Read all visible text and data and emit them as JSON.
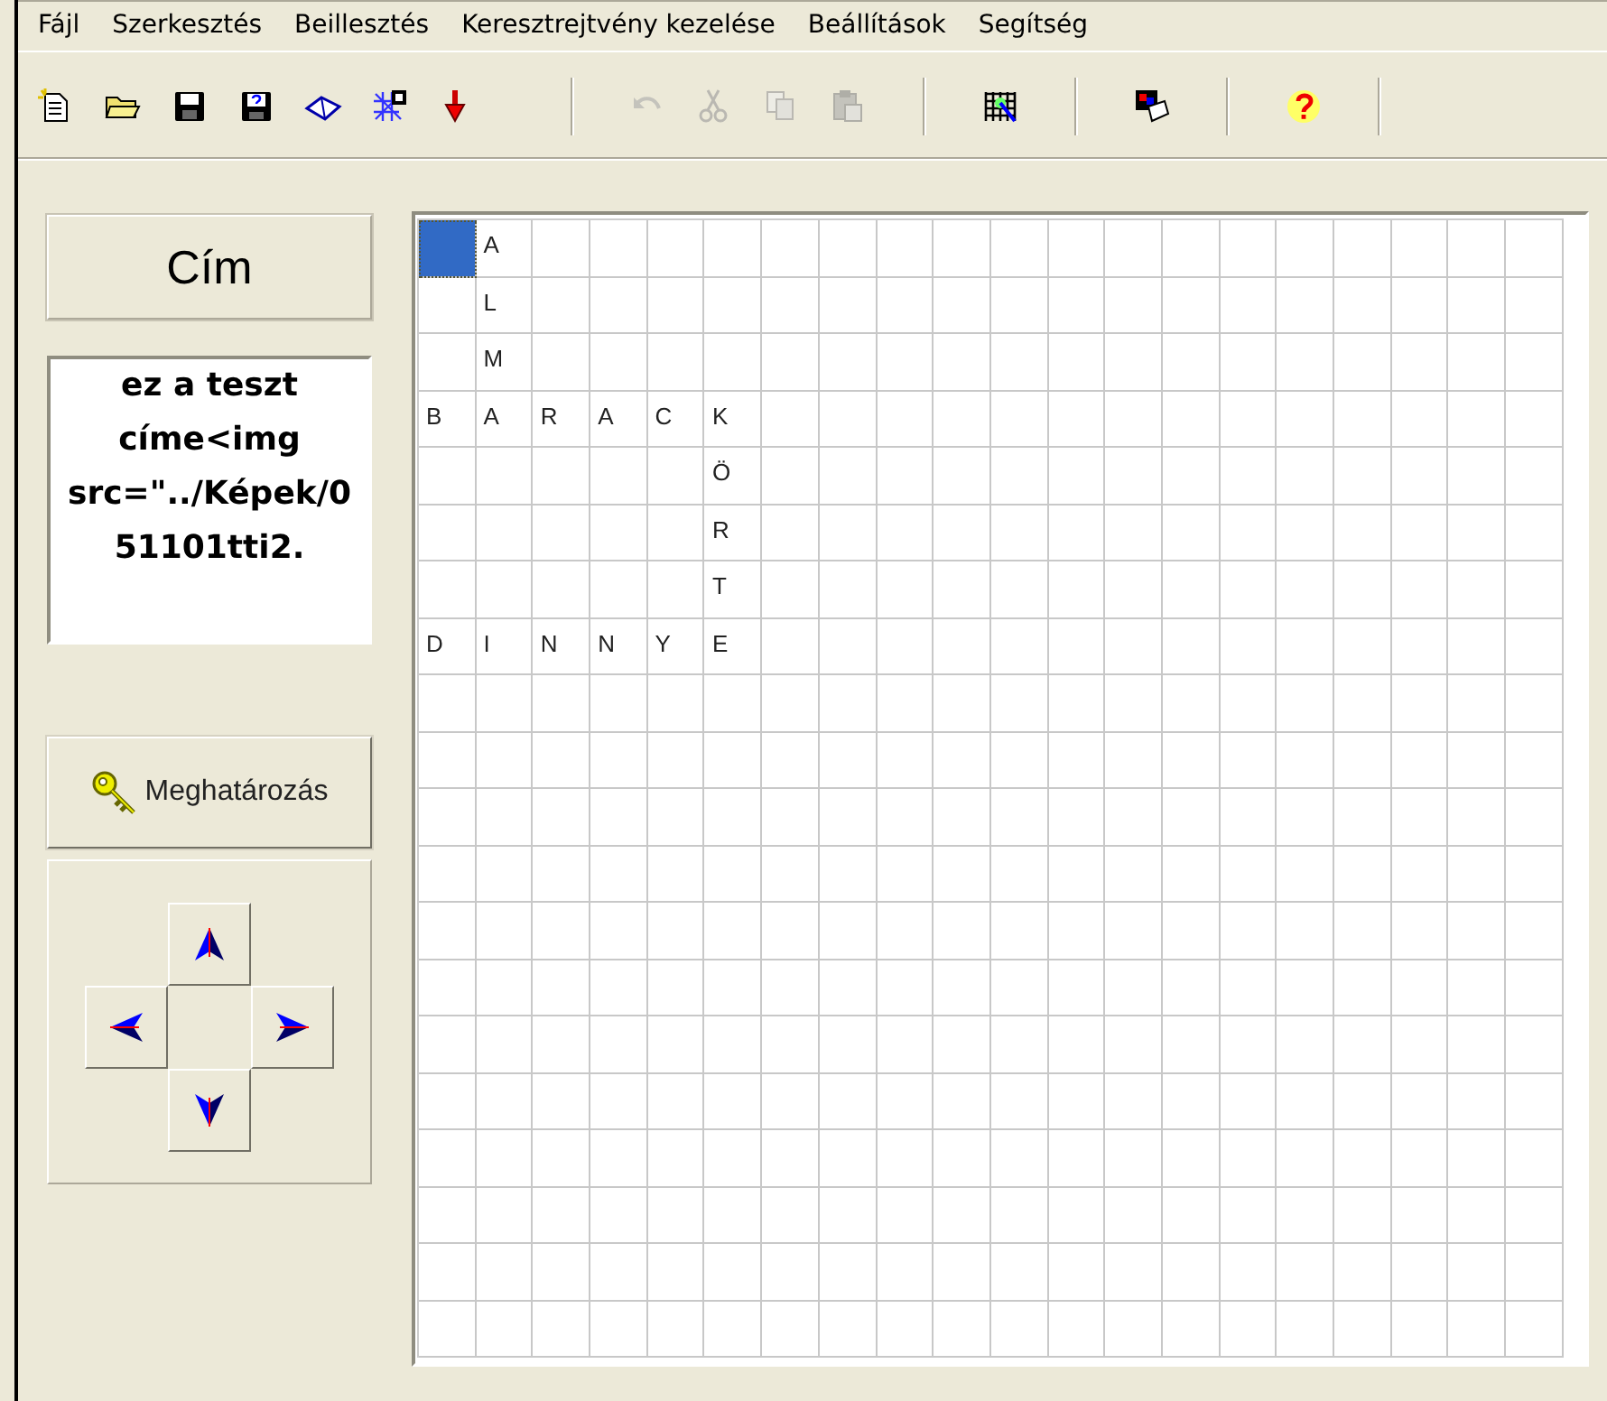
{
  "menu": [
    {
      "label": "Fájl"
    },
    {
      "label": "Szerkesztés"
    },
    {
      "label": "Beillesztés"
    },
    {
      "label": "Keresztrejtvény kezelése"
    },
    {
      "label": "Beállítások"
    },
    {
      "label": "Segítség"
    }
  ],
  "toolbar": [
    {
      "buttons": [
        {
          "disabled": false
        },
        {
          "disabled": false
        },
        {
          "disabled": false
        },
        {
          "disabled": false
        },
        {
          "disabled": false
        },
        {
          "disabled": false
        },
        {
          "disabled": false
        }
      ]
    },
    {
      "buttons": [
        {
          "disabled": true
        },
        {
          "disabled": true
        },
        {
          "disabled": true
        },
        {
          "disabled": true
        }
      ]
    },
    {
      "buttons": [
        {
          "disabled": false
        }
      ]
    },
    {
      "buttons": [
        {
          "disabled": false
        }
      ]
    },
    {
      "buttons": [
        {
          "disabled": false
        }
      ]
    }
  ],
  "title_button": {
    "label": "Cím"
  },
  "title_text": "ez a teszt címe<img src=\"../Képek/051101tti2.",
  "define_button": {
    "label": "Meghatározás"
  },
  "grid": {
    "rows": [
      [
        {
          "selected": true
        },
        {
          "letter": "A",
          "selected": false
        }
      ],
      [
        {
          "selected": false
        },
        {
          "letter": "L",
          "selected": false
        }
      ],
      [
        {
          "selected": false
        },
        {
          "letter": "M",
          "selected": false
        }
      ],
      [
        {
          "letter": "B",
          "selected": false
        },
        {
          "letter": "A",
          "selected": false
        },
        {
          "letter": "R",
          "selected": false
        },
        {
          "letter": "A",
          "selected": false
        },
        {
          "letter": "C",
          "selected": false
        },
        {
          "letter": "K",
          "selected": false
        }
      ],
      [
        {
          "selected": false
        },
        {
          "selected": false
        },
        {
          "selected": false
        },
        {
          "selected": false
        },
        {
          "selected": false
        },
        {
          "letter": "Ö",
          "selected": false
        }
      ],
      [
        {
          "selected": false
        },
        {
          "selected": false
        },
        {
          "selected": false
        },
        {
          "selected": false
        },
        {
          "selected": false
        },
        {
          "letter": "R",
          "selected": false
        }
      ],
      [
        {
          "selected": false
        },
        {
          "selected": false
        },
        {
          "selected": false
        },
        {
          "selected": false
        },
        {
          "selected": false
        },
        {
          "letter": "T",
          "selected": false
        }
      ],
      [
        {
          "letter": "D",
          "selected": false
        },
        {
          "letter": "I",
          "selected": false
        },
        {
          "letter": "N",
          "selected": false
        },
        {
          "letter": "N",
          "selected": false
        },
        {
          "letter": "Y",
          "selected": false
        },
        {
          "letter": "E",
          "selected": false
        }
      ]
    ]
  }
}
